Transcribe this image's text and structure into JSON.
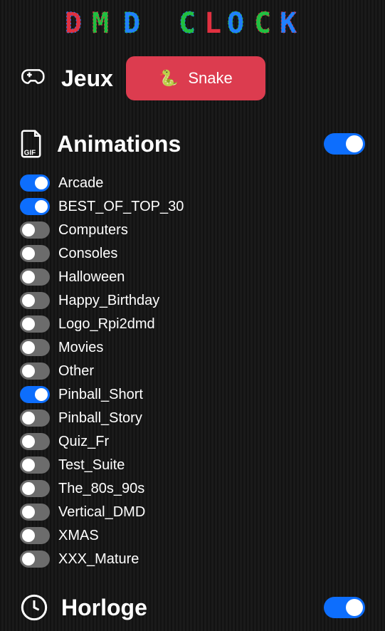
{
  "logo_text": "DMD CLOCK",
  "games": {
    "title": "Jeux",
    "snake_label": "Snake",
    "snake_emoji": "🐍"
  },
  "animations": {
    "title": "Animations",
    "master_enabled": true,
    "items": [
      {
        "label": "Arcade",
        "enabled": true
      },
      {
        "label": "BEST_OF_TOP_30",
        "enabled": true
      },
      {
        "label": "Computers",
        "enabled": false
      },
      {
        "label": "Consoles",
        "enabled": false
      },
      {
        "label": "Halloween",
        "enabled": false
      },
      {
        "label": "Happy_Birthday",
        "enabled": false
      },
      {
        "label": "Logo_Rpi2dmd",
        "enabled": false
      },
      {
        "label": "Movies",
        "enabled": false
      },
      {
        "label": "Other",
        "enabled": false
      },
      {
        "label": "Pinball_Short",
        "enabled": true
      },
      {
        "label": "Pinball_Story",
        "enabled": false
      },
      {
        "label": "Quiz_Fr",
        "enabled": false
      },
      {
        "label": "Test_Suite",
        "enabled": false
      },
      {
        "label": "The_80s_90s",
        "enabled": false
      },
      {
        "label": "Vertical_DMD",
        "enabled": false
      },
      {
        "label": "XMAS",
        "enabled": false
      },
      {
        "label": "XXX_Mature",
        "enabled": false
      }
    ]
  },
  "clock": {
    "title": "Horloge",
    "enabled": true
  }
}
